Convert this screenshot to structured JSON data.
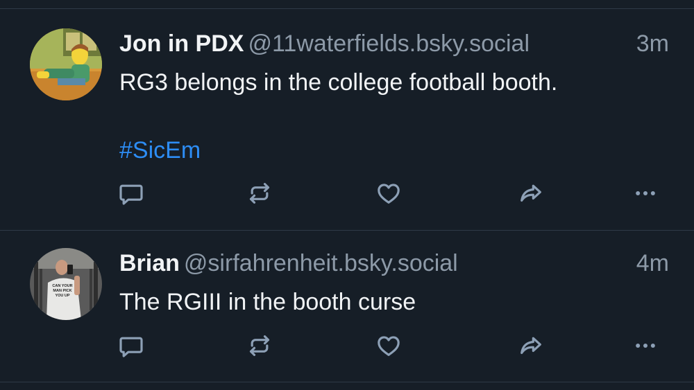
{
  "colors": {
    "background": "#161e27",
    "divider": "#2e3a47",
    "text_primary": "#f1f3f5",
    "text_secondary": "#8d9aa8",
    "icon": "#8da0b6",
    "link": "#2d8df5"
  },
  "posts": [
    {
      "display_name": "Jon in PDX",
      "handle": "@11waterfields.bsky.social",
      "time": "3m",
      "text": "RG3 belongs in the college football booth.",
      "hashtag": "#SicEm",
      "avatar_icon": "cartoon-character-avatar",
      "actions": [
        "reply-icon",
        "repost-icon",
        "like-icon",
        "share-icon",
        "more-icon"
      ]
    },
    {
      "display_name": "Brian",
      "handle": "@sirfahrenheit.bsky.social",
      "time": "4m",
      "text": "The RGIII in the booth curse",
      "avatar_shirt_text": "CAN YOUR MAN PICK YOU UP",
      "avatar_icon": "gym-selfie-avatar",
      "actions": [
        "reply-icon",
        "repost-icon",
        "like-icon",
        "share-icon",
        "more-icon"
      ]
    }
  ]
}
